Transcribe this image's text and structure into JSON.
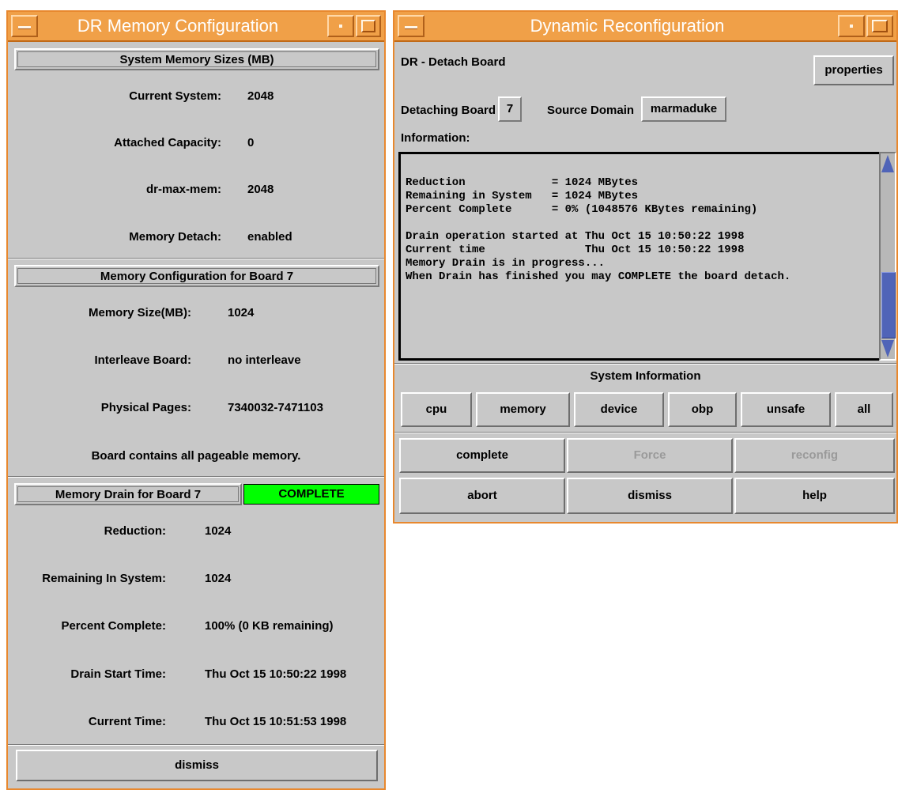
{
  "left_window": {
    "title": "DR Memory Configuration",
    "section1": {
      "header": "System Memory Sizes (MB)",
      "rows": [
        {
          "label": "Current System:",
          "value": "2048"
        },
        {
          "label": "Attached Capacity:",
          "value": "0"
        },
        {
          "label": "dr-max-mem:",
          "value": "2048"
        },
        {
          "label": "Memory Detach:",
          "value": "enabled"
        }
      ]
    },
    "section2": {
      "header": "Memory Configuration for Board  7",
      "rows": [
        {
          "label": "Memory Size(MB):",
          "value": "1024"
        },
        {
          "label": "Interleave Board:",
          "value": "no interleave"
        },
        {
          "label": "Physical Pages:",
          "value": "7340032-7471103"
        }
      ],
      "note": "Board contains all pageable memory."
    },
    "section3": {
      "header": "Memory Drain for Board 7",
      "status": "COMPLETE",
      "status_color": "#00ff00",
      "rows": [
        {
          "label": "Reduction:",
          "value": "1024"
        },
        {
          "label": "Remaining In System:",
          "value": "1024"
        },
        {
          "label": "Percent Complete:",
          "value": "100% (0 KB remaining)"
        },
        {
          "label": "Drain Start Time:",
          "value": "Thu Oct 15 10:50:22 1998"
        },
        {
          "label": "Current Time:",
          "value": "Thu Oct 15 10:51:53 1998"
        }
      ]
    },
    "dismiss_label": "dismiss"
  },
  "right_window": {
    "title": "Dynamic Reconfiguration",
    "operation": "DR - Detach Board",
    "properties_label": "properties",
    "detaching_board_label": "Detaching Board",
    "detaching_board_value": "7",
    "source_domain_label": "Source Domain",
    "source_domain_value": "marmaduke",
    "information_label": "Information:",
    "info_lines": [
      "Reduction             = 1024 MBytes",
      "Remaining in System   = 1024 MBytes",
      "Percent Complete      = 0% (1048576 KBytes remaining)",
      "",
      "Drain operation started at Thu Oct 15 10:50:22 1998",
      "Current time               Thu Oct 15 10:50:22 1998",
      "Memory Drain is in progress...",
      "When Drain has finished you may COMPLETE the board detach."
    ],
    "system_info_label": "System Information",
    "sysinfo_buttons": [
      "cpu",
      "memory",
      "device",
      "obp",
      "unsafe",
      "all"
    ],
    "action_buttons": [
      "complete",
      "Force",
      "reconfig"
    ],
    "bottom_buttons": [
      "abort",
      "dismiss",
      "help"
    ]
  },
  "colors": {
    "title_bar": "#f0a048",
    "window_frame": "#e8882e",
    "panel": "#c8c8c8",
    "scrollbar_thumb": "#5064b8",
    "status_complete": "#00ff00"
  }
}
